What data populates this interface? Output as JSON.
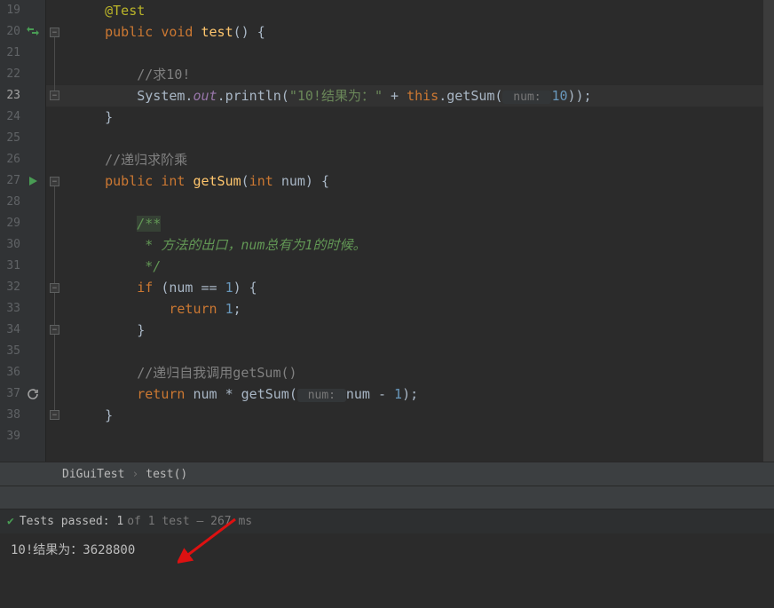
{
  "lines": {
    "start": 19,
    "end": 39,
    "active": 23
  },
  "code": {
    "l19": {
      "ann": "@Test"
    },
    "l20": {
      "kw1": "public void ",
      "mtd": "test",
      "rest": "() {"
    },
    "l22": {
      "cmt": "//求10!"
    },
    "l23": {
      "p1": "System.",
      "fld": "out",
      "p2": ".println(",
      "str": "\"10!结果为：\"",
      "p3": " + ",
      "kw": "this",
      "p4": ".getSum(",
      "hint": " num: ",
      "num": "10",
      "p5": "));"
    },
    "l24": {
      "txt": "}"
    },
    "l26": {
      "cmt": "//递归求阶乘"
    },
    "l27": {
      "kw1": "public int ",
      "mtd": "getSum",
      "p1": "(",
      "kw2": "int ",
      "arg": "num",
      "p2": ") {"
    },
    "l29": {
      "doc": "/**"
    },
    "l30": {
      "doc": " * 方法的出口，num总有为1的时候。"
    },
    "l31": {
      "doc": " */"
    },
    "l32": {
      "kw": "if ",
      "p1": "(num == ",
      "num": "1",
      "p2": ") {"
    },
    "l33": {
      "kw": "return ",
      "num": "1",
      "p": ";"
    },
    "l34": {
      "txt": "}"
    },
    "l36": {
      "cmt": "//递归自我调用getSum()"
    },
    "l37": {
      "kw": "return ",
      "p1": "num * getSum(",
      "hint": " num: ",
      "p2": "num - ",
      "num": "1",
      "p3": ");"
    },
    "l38": {
      "txt": "}"
    }
  },
  "breadcrumb": {
    "class": "DiGuiTest",
    "method": "test()",
    "sep": "›"
  },
  "tests": {
    "check": "✔",
    "passed_label": "Tests passed:",
    "passed_count": "1",
    "total_text": "of 1 test –",
    "time": "267 ms"
  },
  "console": {
    "output": "10!结果为：3628800"
  },
  "gutter_icons": {
    "swap_line": 20,
    "run_line": 27,
    "refresh_line": 37
  }
}
